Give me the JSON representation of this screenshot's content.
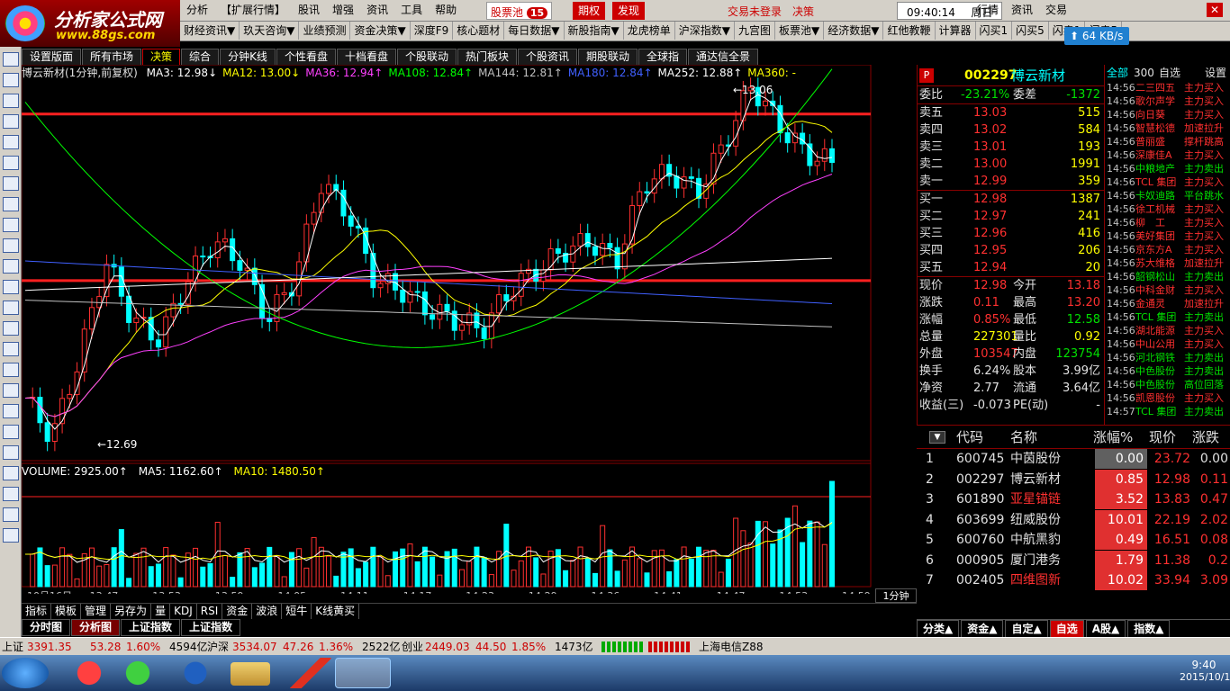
{
  "app": {
    "logo_text": "分析家公式网",
    "logo_url": "www.88gs.com"
  },
  "menu": [
    "分析",
    "【扩展行情】",
    "股讯",
    "增强",
    "资讯",
    "工具",
    "帮助"
  ],
  "menu_right": {
    "pool": "股票池",
    "pool_count": "15",
    "qiquan": "期权",
    "faxian": "发现",
    "login": "交易未登录",
    "juece": "决策",
    "time": "09:40:14",
    "weekday": "周日",
    "hangqing": "行情",
    "zixun": "资讯",
    "jiaoyi": "交易",
    "speed": "64 KB/s"
  },
  "toolbar2": [
    "财经资讯▼",
    "玖天咨询▼",
    "业绩预测",
    "资金决策▼",
    "深度F9",
    "核心题材",
    "每日数据▼",
    "新股指南▼",
    "龙虎榜单",
    "沪深指数▼",
    "九宫图",
    "板票池▼",
    "经济数据▼",
    "红他教鞭",
    "计算器",
    "闪买1",
    "闪买5",
    "闪卖1",
    "闪卖5"
  ],
  "tabs": [
    "设置版面",
    "所有市场",
    "决策",
    "综合",
    "分钟K线",
    "个性看盘",
    "十档看盘",
    "个股联动",
    "热门板块",
    "个股资讯",
    "期股联动",
    "全球指",
    "通达信全景"
  ],
  "active_tab": "决策",
  "chart": {
    "title": "博云新材(1分钟,前复权)",
    "ma_labels": [
      {
        "t": "MA3: 12.98↓",
        "c": "#ffffff"
      },
      {
        "t": "MA12: 13.00↓",
        "c": "#ffff00"
      },
      {
        "t": "MA36: 12.94↑",
        "c": "#ff40ff"
      },
      {
        "t": "MA108: 12.84↑",
        "c": "#00ff00"
      },
      {
        "t": "MA144: 12.81↑",
        "c": "#c0c0c0"
      },
      {
        "t": "MA180: 12.84↑",
        "c": "#4060ff"
      },
      {
        "t": "MA252: 12.88↑",
        "c": "#ffffff"
      },
      {
        "t": "MA360: -",
        "c": "#ffff00"
      }
    ],
    "high_label": "13.06",
    "low_label": "12.69",
    "price_axis": [
      "13.05",
      "13.03",
      "13.00",
      "12.98",
      "12.95",
      "12.93",
      "12.90",
      "12.88",
      "12.85",
      "12.83",
      "12.80",
      "12.78",
      "12.75",
      "12.73",
      "12.70"
    ],
    "vol_labels": [
      {
        "t": "VOLUME: 2925.00↑",
        "c": "#ffffff"
      },
      {
        "t": "MA5: 1162.60↑",
        "c": "#ffffff"
      },
      {
        "t": "MA10: 1480.50↑",
        "c": "#ffff00"
      }
    ],
    "vol_axis": [
      "3000",
      "2000",
      "1000"
    ],
    "time_axis": [
      "10月16日",
      "13:47",
      "13:53",
      "13:59",
      "14:05",
      "14:11",
      "14:17",
      "14:23",
      "14:29",
      "14:36",
      "14:41",
      "14:47",
      "14:53",
      "14:59"
    ],
    "period": "1分钟",
    "bottom_tools": [
      "指标",
      "模板",
      "管理",
      "另存为",
      "量",
      "KDJ",
      "RSI",
      "资金",
      "波浪",
      "短牛",
      "K线黄买"
    ]
  },
  "quote": {
    "code": "002297",
    "name": "博云新材",
    "weibi_l": "委比",
    "weibi": "-23.21%",
    "weicha_l": "委差",
    "weicha": "-1372",
    "sell": [
      {
        "l": "卖五",
        "p": "13.03",
        "v": "515"
      },
      {
        "l": "卖四",
        "p": "13.02",
        "v": "584"
      },
      {
        "l": "卖三",
        "p": "13.01",
        "v": "193"
      },
      {
        "l": "卖二",
        "p": "13.00",
        "v": "1991"
      },
      {
        "l": "卖一",
        "p": "12.99",
        "v": "359"
      }
    ],
    "buy": [
      {
        "l": "买一",
        "p": "12.98",
        "v": "1387"
      },
      {
        "l": "买二",
        "p": "12.97",
        "v": "241"
      },
      {
        "l": "买三",
        "p": "12.96",
        "v": "416"
      },
      {
        "l": "买四",
        "p": "12.95",
        "v": "206"
      },
      {
        "l": "买五",
        "p": "12.94",
        "v": "20"
      }
    ],
    "stats": [
      [
        "现价",
        "12.98",
        "今开",
        "13.18"
      ],
      [
        "涨跌",
        "0.11",
        "最高",
        "13.20"
      ],
      [
        "涨幅",
        "0.85%",
        "最低",
        "12.58"
      ],
      [
        "总量",
        "227301",
        "量比",
        "0.92"
      ],
      [
        "外盘",
        "103547",
        "内盘",
        "123754"
      ],
      [
        "换手",
        "6.24%",
        "股本",
        "3.99亿"
      ],
      [
        "净资",
        "2.77",
        "流通",
        "3.64亿"
      ],
      [
        "收益(三)",
        "-0.073",
        "PE(动)",
        "-"
      ]
    ]
  },
  "ticks_header": {
    "all": "全部",
    "n": "300",
    "zx": "自选",
    "set": "设置"
  },
  "ticks": [
    [
      "14:56",
      "二三四五",
      "主力买入"
    ],
    [
      "14:56",
      "歌尔声学",
      "主力买入"
    ],
    [
      "14:56",
      "向日葵",
      "主力买入"
    ],
    [
      "14:56",
      "智慧松德",
      "加速拉升"
    ],
    [
      "14:56",
      "普丽盛",
      "撑杆跳高"
    ],
    [
      "14:56",
      "深康佳A",
      "主力买入"
    ],
    [
      "14:56",
      "中粮地产",
      "主力卖出"
    ],
    [
      "14:56",
      "TCL 集团",
      "主力买入"
    ],
    [
      "14:56",
      "卡奴迪路",
      "平台跳水"
    ],
    [
      "14:56",
      "徐工机械",
      "主力买入"
    ],
    [
      "14:56",
      "柳　工",
      "主力买入"
    ],
    [
      "14:56",
      "美好集团",
      "主力买入"
    ],
    [
      "14:56",
      "京东方A",
      "主力买入"
    ],
    [
      "14:56",
      "苏大维格",
      "加速拉升"
    ],
    [
      "14:56",
      "韶钢松山",
      "主力卖出"
    ],
    [
      "14:56",
      "中科金财",
      "主力买入"
    ],
    [
      "14:56",
      "金通灵",
      "加速拉升"
    ],
    [
      "14:56",
      "TCL 集团",
      "主力卖出"
    ],
    [
      "14:56",
      "湖北能源",
      "主力买入"
    ],
    [
      "14:56",
      "中山公用",
      "主力买入"
    ],
    [
      "14:56",
      "河北钢铁",
      "主力卖出"
    ],
    [
      "14:56",
      "中色股份",
      "主力卖出"
    ],
    [
      "14:56",
      "中色股份",
      "高位回落"
    ],
    [
      "14:56",
      "凯恩股份",
      "主力买入"
    ],
    [
      "14:57",
      "TCL 集团",
      "主力卖出"
    ]
  ],
  "watch_header": [
    "代码",
    "名称",
    "涨幅%",
    "现价",
    "涨跌"
  ],
  "watch": [
    [
      "1",
      "600745",
      "中茵股份",
      "0.00",
      "23.72",
      "0.00"
    ],
    [
      "2",
      "002297",
      "博云新材",
      "0.85",
      "12.98",
      "0.11"
    ],
    [
      "3",
      "601890",
      "亚星锚链",
      "3.52",
      "13.83",
      "0.47"
    ],
    [
      "4",
      "603699",
      "纽威股份",
      "10.01",
      "22.19",
      "2.02"
    ],
    [
      "5",
      "600760",
      "中航黑豹",
      "0.49",
      "16.51",
      "0.08"
    ],
    [
      "6",
      "000905",
      "厦门港务",
      "1.79",
      "11.38",
      "0.2"
    ],
    [
      "7",
      "002405",
      "四维图新",
      "10.02",
      "33.94",
      "3.09"
    ]
  ],
  "bottom_tabs": [
    "分时图",
    "分析图",
    "上证指数",
    "上证指数"
  ],
  "right_tabs": [
    "分类▲",
    "资金▲",
    "自定▲",
    "自选",
    "A股▲",
    "指数▲"
  ],
  "status": {
    "sh_l": "上证",
    "sh": "3391.35",
    "sh_c": "53.28",
    "sh_p": "1.60%",
    "sh_v": "4594亿",
    "sz_l": "沪深",
    "sz": "3534.07",
    "sz_c": "47.26",
    "sz_p": "1.36%",
    "sz_v": "2522亿",
    "cy_l": "创业",
    "cy": "2449.03",
    "cy_c": "44.50",
    "cy_p": "1.85%",
    "cy_v": "1473亿",
    "net": "上海电信Z88"
  },
  "clock": {
    "time": "9:40",
    "date": "2015/10/18"
  }
}
